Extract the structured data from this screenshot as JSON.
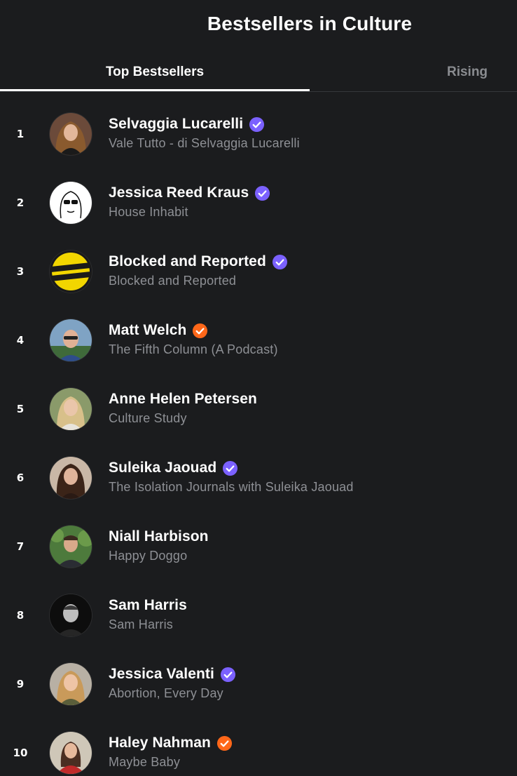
{
  "header": {
    "title": "Bestsellers in Culture"
  },
  "tabs": [
    {
      "label": "Top Bestsellers",
      "active": true
    },
    {
      "label": "Rising",
      "active": false
    }
  ],
  "colors": {
    "badge_purple": "#7b61ff",
    "badge_orange": "#ff6719",
    "background": "#1b1c1e",
    "muted_text": "#8e9095"
  },
  "list": [
    {
      "rank": "1",
      "name": "Selvaggia Lucarelli",
      "publication": "Vale Tutto - di Selvaggia Lucarelli",
      "badge": "purple-check-icon"
    },
    {
      "rank": "2",
      "name": "Jessica Reed Kraus",
      "publication": "House Inhabit",
      "badge": "purple-check-icon"
    },
    {
      "rank": "3",
      "name": "Blocked and Reported",
      "publication": "Blocked and Reported",
      "badge": "purple-check-icon"
    },
    {
      "rank": "4",
      "name": "Matt Welch",
      "publication": "The Fifth Column (A Podcast)",
      "badge": "orange-check-icon"
    },
    {
      "rank": "5",
      "name": "Anne Helen Petersen",
      "publication": "Culture Study",
      "badge": ""
    },
    {
      "rank": "6",
      "name": "Suleika Jaouad",
      "publication": "The Isolation Journals with Suleika Jaouad",
      "badge": "purple-check-icon"
    },
    {
      "rank": "7",
      "name": "Niall Harbison",
      "publication": "Happy Doggo",
      "badge": ""
    },
    {
      "rank": "8",
      "name": "Sam Harris",
      "publication": "Sam Harris",
      "badge": ""
    },
    {
      "rank": "9",
      "name": "Jessica Valenti",
      "publication": "Abortion, Every Day",
      "badge": "purple-check-icon"
    },
    {
      "rank": "10",
      "name": "Haley Nahman",
      "publication": "Maybe Baby",
      "badge": "orange-check-icon"
    }
  ]
}
